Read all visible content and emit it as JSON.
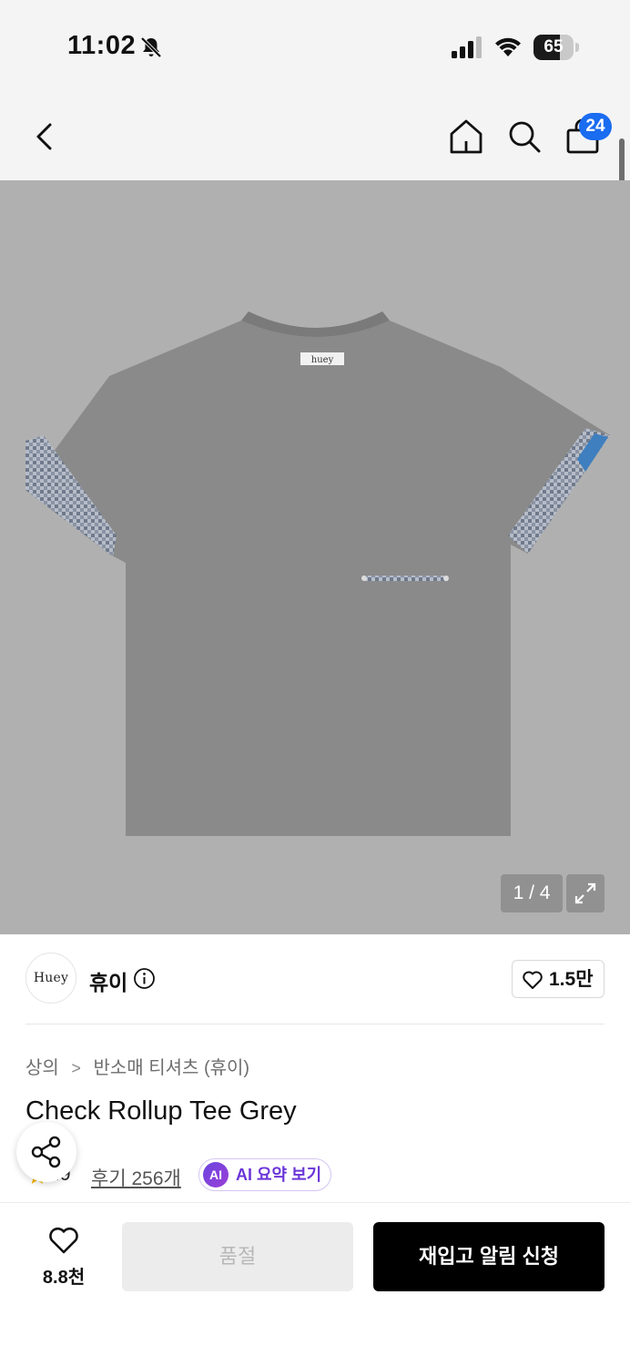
{
  "status_bar": {
    "time": "11:02",
    "battery": "65",
    "battery_level": 0.65,
    "icons": [
      "bell-slash-icon",
      "cellular-signal-icon",
      "wifi-icon",
      "battery-icon"
    ]
  },
  "nav": {
    "icons": [
      "back-chevron-icon",
      "home-icon",
      "search-icon",
      "shopping-bag-icon"
    ],
    "cart_badge": "24"
  },
  "gallery": {
    "counter": "1 / 4",
    "image_label": "huey",
    "icons": [
      "expand-icon"
    ]
  },
  "brand": {
    "logo_text": "Huey",
    "name": "휴이",
    "likes": "1.5만",
    "icons": [
      "info-icon",
      "heart-outline-icon"
    ]
  },
  "product": {
    "breadcrumb": [
      "상의",
      "반소매 티셔츠 (휴이)"
    ],
    "breadcrumb_separator": ">",
    "title": "Check Rollup Tee Grey",
    "rating": ".9",
    "reviews": "후기 256개",
    "ai_badge": "AI",
    "ai_label": "AI 요약 보기",
    "icons": [
      "share-icon",
      "star-icon"
    ]
  },
  "bottom": {
    "wish_count": "8.8천",
    "soldout_label": "품절",
    "restock_label": "재입고 알림 신청",
    "icons": [
      "heart-outline-icon"
    ]
  },
  "colors": {
    "accent_badge": "#1a6cf0",
    "ai_purple": "#6b35d8",
    "primary_button": "#000000",
    "disabled_button": "#ececec",
    "gallery_bg": "#b0b0b0",
    "shirt_grey": "#8a8a8a",
    "star": "#f5b400"
  }
}
